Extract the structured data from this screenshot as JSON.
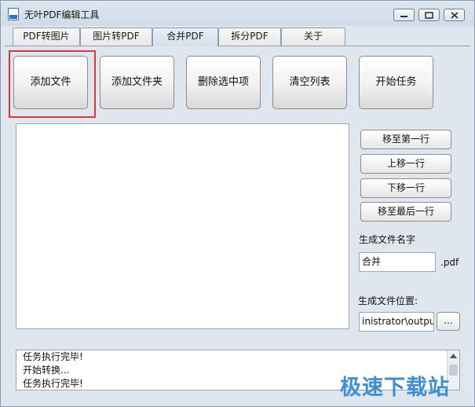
{
  "window": {
    "title": "无叶PDF编辑工具"
  },
  "tabs": [
    {
      "label": "PDF转图片"
    },
    {
      "label": "图片转PDF"
    },
    {
      "label": "合并PDF"
    },
    {
      "label": "拆分PDF"
    },
    {
      "label": "关于"
    }
  ],
  "active_tab": "合并PDF",
  "toolbar": {
    "add_file": "添加文件",
    "add_folder": "添加文件夹",
    "delete_selected": "删除选中项",
    "clear_list": "清空列表",
    "start_task": "开始任务"
  },
  "side": {
    "move_top": "移至第一行",
    "move_up": "上移一行",
    "move_down": "下移一行",
    "move_bottom": "移至最后一行",
    "output_name_label": "生成文件名字",
    "output_name_value": "合并",
    "extension": ".pdf",
    "output_location_label": "生成文件位置:",
    "output_location_value": "inistrator\\output",
    "browse": "..."
  },
  "log": {
    "lines": [
      "任务执行完毕!",
      "开始转换...",
      "任务执行完毕!"
    ]
  },
  "watermark": "极速下载站",
  "colors": {
    "highlight": "#d83a3a",
    "watermark": "#3b8fd6",
    "window_bg": "#dfe6ee"
  },
  "icons": {
    "app": "pdf-app-icon",
    "minimize": "minimize-icon",
    "maximize": "maximize-icon",
    "close": "close-icon"
  }
}
